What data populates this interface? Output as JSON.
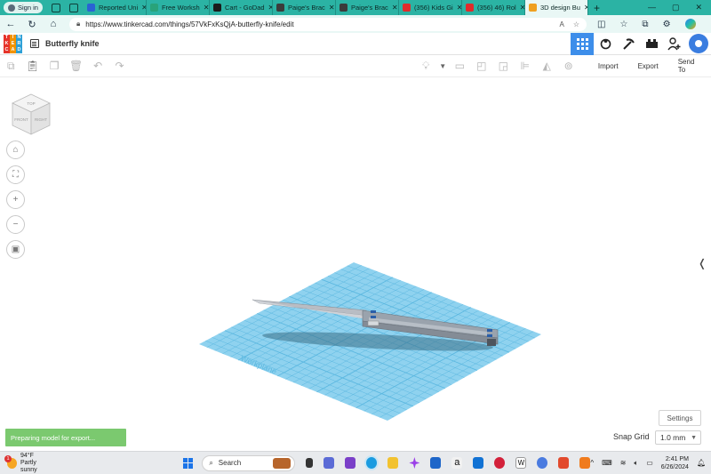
{
  "browser": {
    "signin_label": "Sign in",
    "tabs": [
      {
        "title": "Reported Uni",
        "color": "#2a62d4"
      },
      {
        "title": "Free Worksh",
        "color": "#29a37a"
      },
      {
        "title": "Cart - GoDad",
        "color": "#1b1b1b"
      },
      {
        "title": "Paige's Brac",
        "color": "#3b3b3b"
      },
      {
        "title": "Paige's Brac",
        "color": "#3b3b3b"
      },
      {
        "title": "(356) Kids Gi",
        "color": "#e02b2b"
      },
      {
        "title": "(356) 46) Rol",
        "color": "#e02b2b"
      },
      {
        "title": "3D design Bu",
        "color": "#f0a020"
      }
    ],
    "url": "https://www.tinkercad.com/things/57VkFxKsQjA-butterfly-knife/edit"
  },
  "app": {
    "logo_letters": [
      "T",
      "I",
      "N",
      "K",
      "E",
      "R",
      "C",
      "A",
      "D"
    ],
    "logo_colors": [
      "#e6332a",
      "#f29200",
      "#2da0d7",
      "#e6332a",
      "#f29200",
      "#2da0d7",
      "#e6332a",
      "#f29200",
      "#2da0d7"
    ],
    "design_title": "Butterfly knife",
    "accent": "#3d8eea"
  },
  "toolbar": {
    "import_label": "Import",
    "export_label": "Export",
    "sendto_label": "Send To"
  },
  "viewcube": {
    "top": "TOP",
    "front": "FRONT",
    "right": "RIGHT"
  },
  "workplane": {
    "grid_color": "#8fd2ef",
    "line_color": "#5cb8e0",
    "watermark": "Workplane"
  },
  "status": {
    "toast": "Preparing model for export...",
    "settings_label": "Settings",
    "snap_label": "Snap Grid",
    "snap_value": "1.0 mm"
  },
  "taskbar": {
    "temperature": "94°F",
    "condition": "Partly sunny",
    "weather_badge": "1",
    "search_label": "Search",
    "time": "2:41 PM",
    "date": "6/26/2024"
  }
}
